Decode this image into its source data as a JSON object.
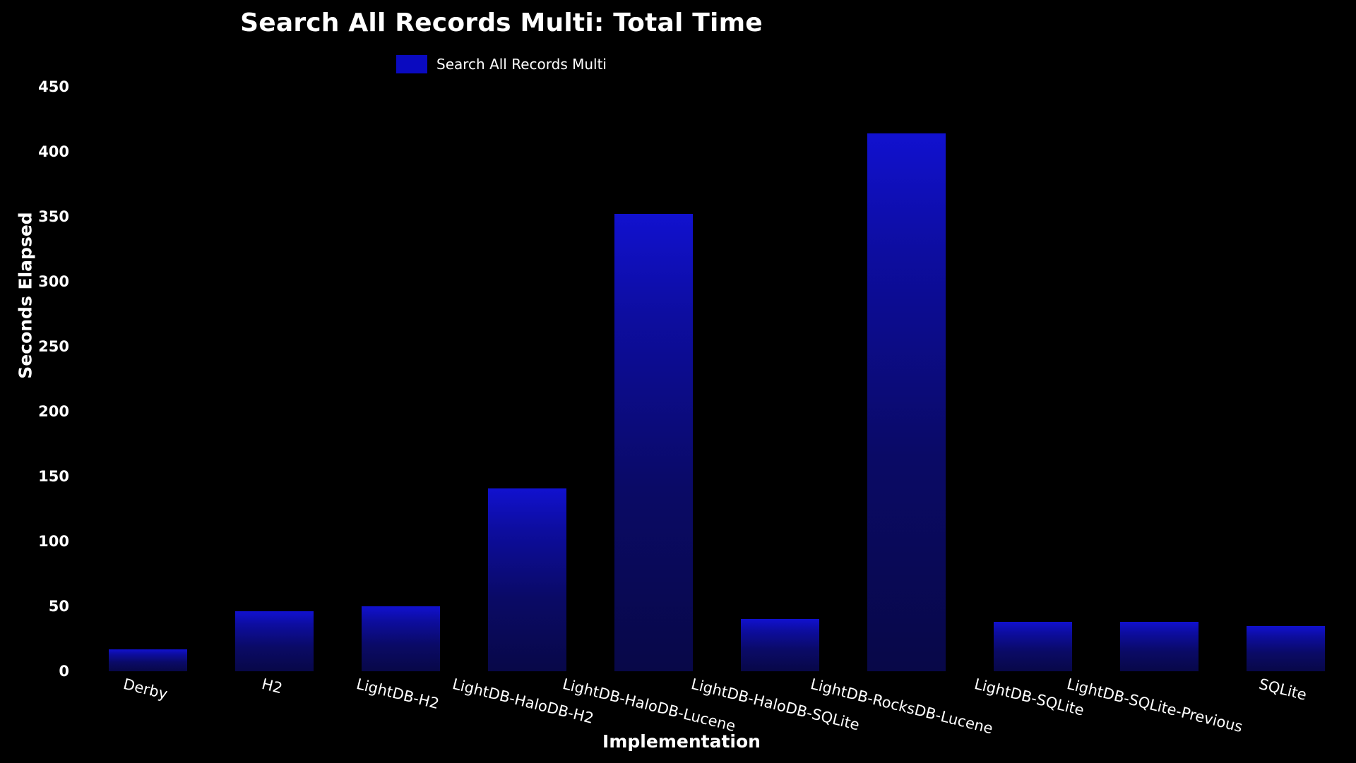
{
  "chart_data": {
    "type": "bar",
    "title": "Search All Records Multi: Total Time",
    "xlabel": "Implementation",
    "ylabel": "Seconds Elapsed",
    "categories": [
      "Derby",
      "H2",
      "LightDB-H2",
      "LightDB-HaloDB-H2",
      "LightDB-HaloDB-Lucene",
      "LightDB-HaloDB-SQLite",
      "LightDB-RocksDB-Lucene",
      "LightDB-SQLite",
      "LightDB-SQLite-Previous",
      "SQLite"
    ],
    "values": [
      17,
      46,
      50,
      141,
      352,
      40,
      414,
      38,
      38,
      35
    ],
    "series": [
      {
        "name": "Search All Records Multi",
        "values": [
          17,
          46,
          50,
          141,
          352,
          40,
          414,
          38,
          38,
          35
        ],
        "color": "#0a0ac0"
      }
    ],
    "ylim": [
      0,
      450
    ],
    "yticks": [
      450,
      400,
      350,
      300,
      250,
      200,
      150,
      100,
      50,
      0
    ],
    "ytick_labels": [
      "450",
      "400",
      "350",
      "300",
      "250",
      "200",
      "150",
      "100",
      "50",
      "0"
    ],
    "grid": false,
    "legend": {
      "position": "top-center",
      "entries": [
        {
          "label": "Search All Records Multi",
          "color": "#0a0ac0"
        }
      ]
    },
    "background_color": "#000000",
    "text_color": "#ffffff"
  }
}
